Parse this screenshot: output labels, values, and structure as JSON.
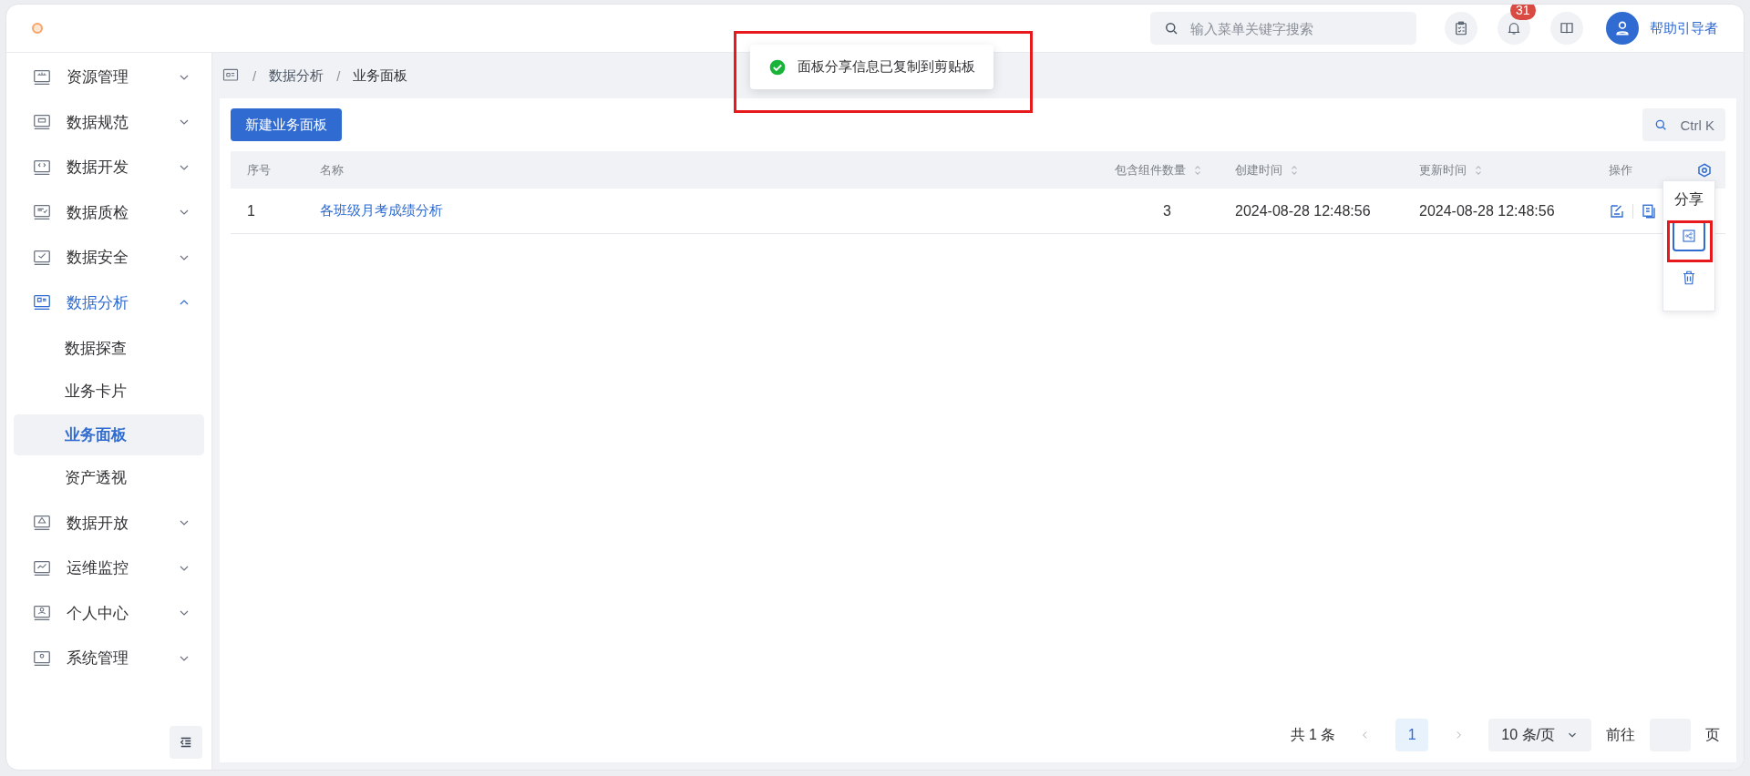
{
  "header": {
    "search": {
      "placeholder": "输入菜单关键字搜索"
    },
    "notification_count": "31",
    "user_name": "帮助引导者"
  },
  "sidebar": {
    "items": [
      {
        "label": "资源管理",
        "selected": false,
        "expanded": false
      },
      {
        "label": "数据规范",
        "selected": false,
        "expanded": false
      },
      {
        "label": "数据开发",
        "selected": false,
        "expanded": false
      },
      {
        "label": "数据质检",
        "selected": false,
        "expanded": false
      },
      {
        "label": "数据安全",
        "selected": false,
        "expanded": false
      },
      {
        "label": "数据分析",
        "selected": true,
        "expanded": true,
        "children": [
          {
            "label": "数据探查",
            "selected": false
          },
          {
            "label": "业务卡片",
            "selected": false
          },
          {
            "label": "业务面板",
            "selected": true
          },
          {
            "label": "资产透视",
            "selected": false
          }
        ]
      },
      {
        "label": "数据开放",
        "selected": false,
        "expanded": false
      },
      {
        "label": "运维监控",
        "selected": false,
        "expanded": false
      },
      {
        "label": "个人中心",
        "selected": false,
        "expanded": false
      },
      {
        "label": "系统管理",
        "selected": false,
        "expanded": false
      }
    ]
  },
  "breadcrumb": {
    "separator": "/",
    "items": [
      "数据分析",
      "业务面板"
    ]
  },
  "toast": {
    "message": "面板分享信息已复制到剪贴板"
  },
  "toolbar": {
    "new_button": "新建业务面板",
    "search_shortcut": "Ctrl K"
  },
  "table": {
    "columns": [
      {
        "label": "序号",
        "sortable": false
      },
      {
        "label": "名称",
        "sortable": false
      },
      {
        "label": "包含组件数量",
        "sortable": true
      },
      {
        "label": "创建时间",
        "sortable": true
      },
      {
        "label": "更新时间",
        "sortable": true
      },
      {
        "label": "操作",
        "sortable": false
      }
    ],
    "rows": [
      {
        "index": "1",
        "name": "各班级月考成绩分析",
        "component_count": "3",
        "created": "2024-08-28 12:48:56",
        "updated": "2024-08-28 12:48:56"
      }
    ]
  },
  "action_menu": {
    "tooltip": "分享",
    "items": [
      {
        "kind": "share",
        "selected": true
      },
      {
        "kind": "delete",
        "selected": false
      }
    ]
  },
  "pagination": {
    "total": "共 1 条",
    "current_page": "1",
    "page_size": "10 条/页",
    "goto_label": "前往",
    "page_suffix": "页"
  }
}
